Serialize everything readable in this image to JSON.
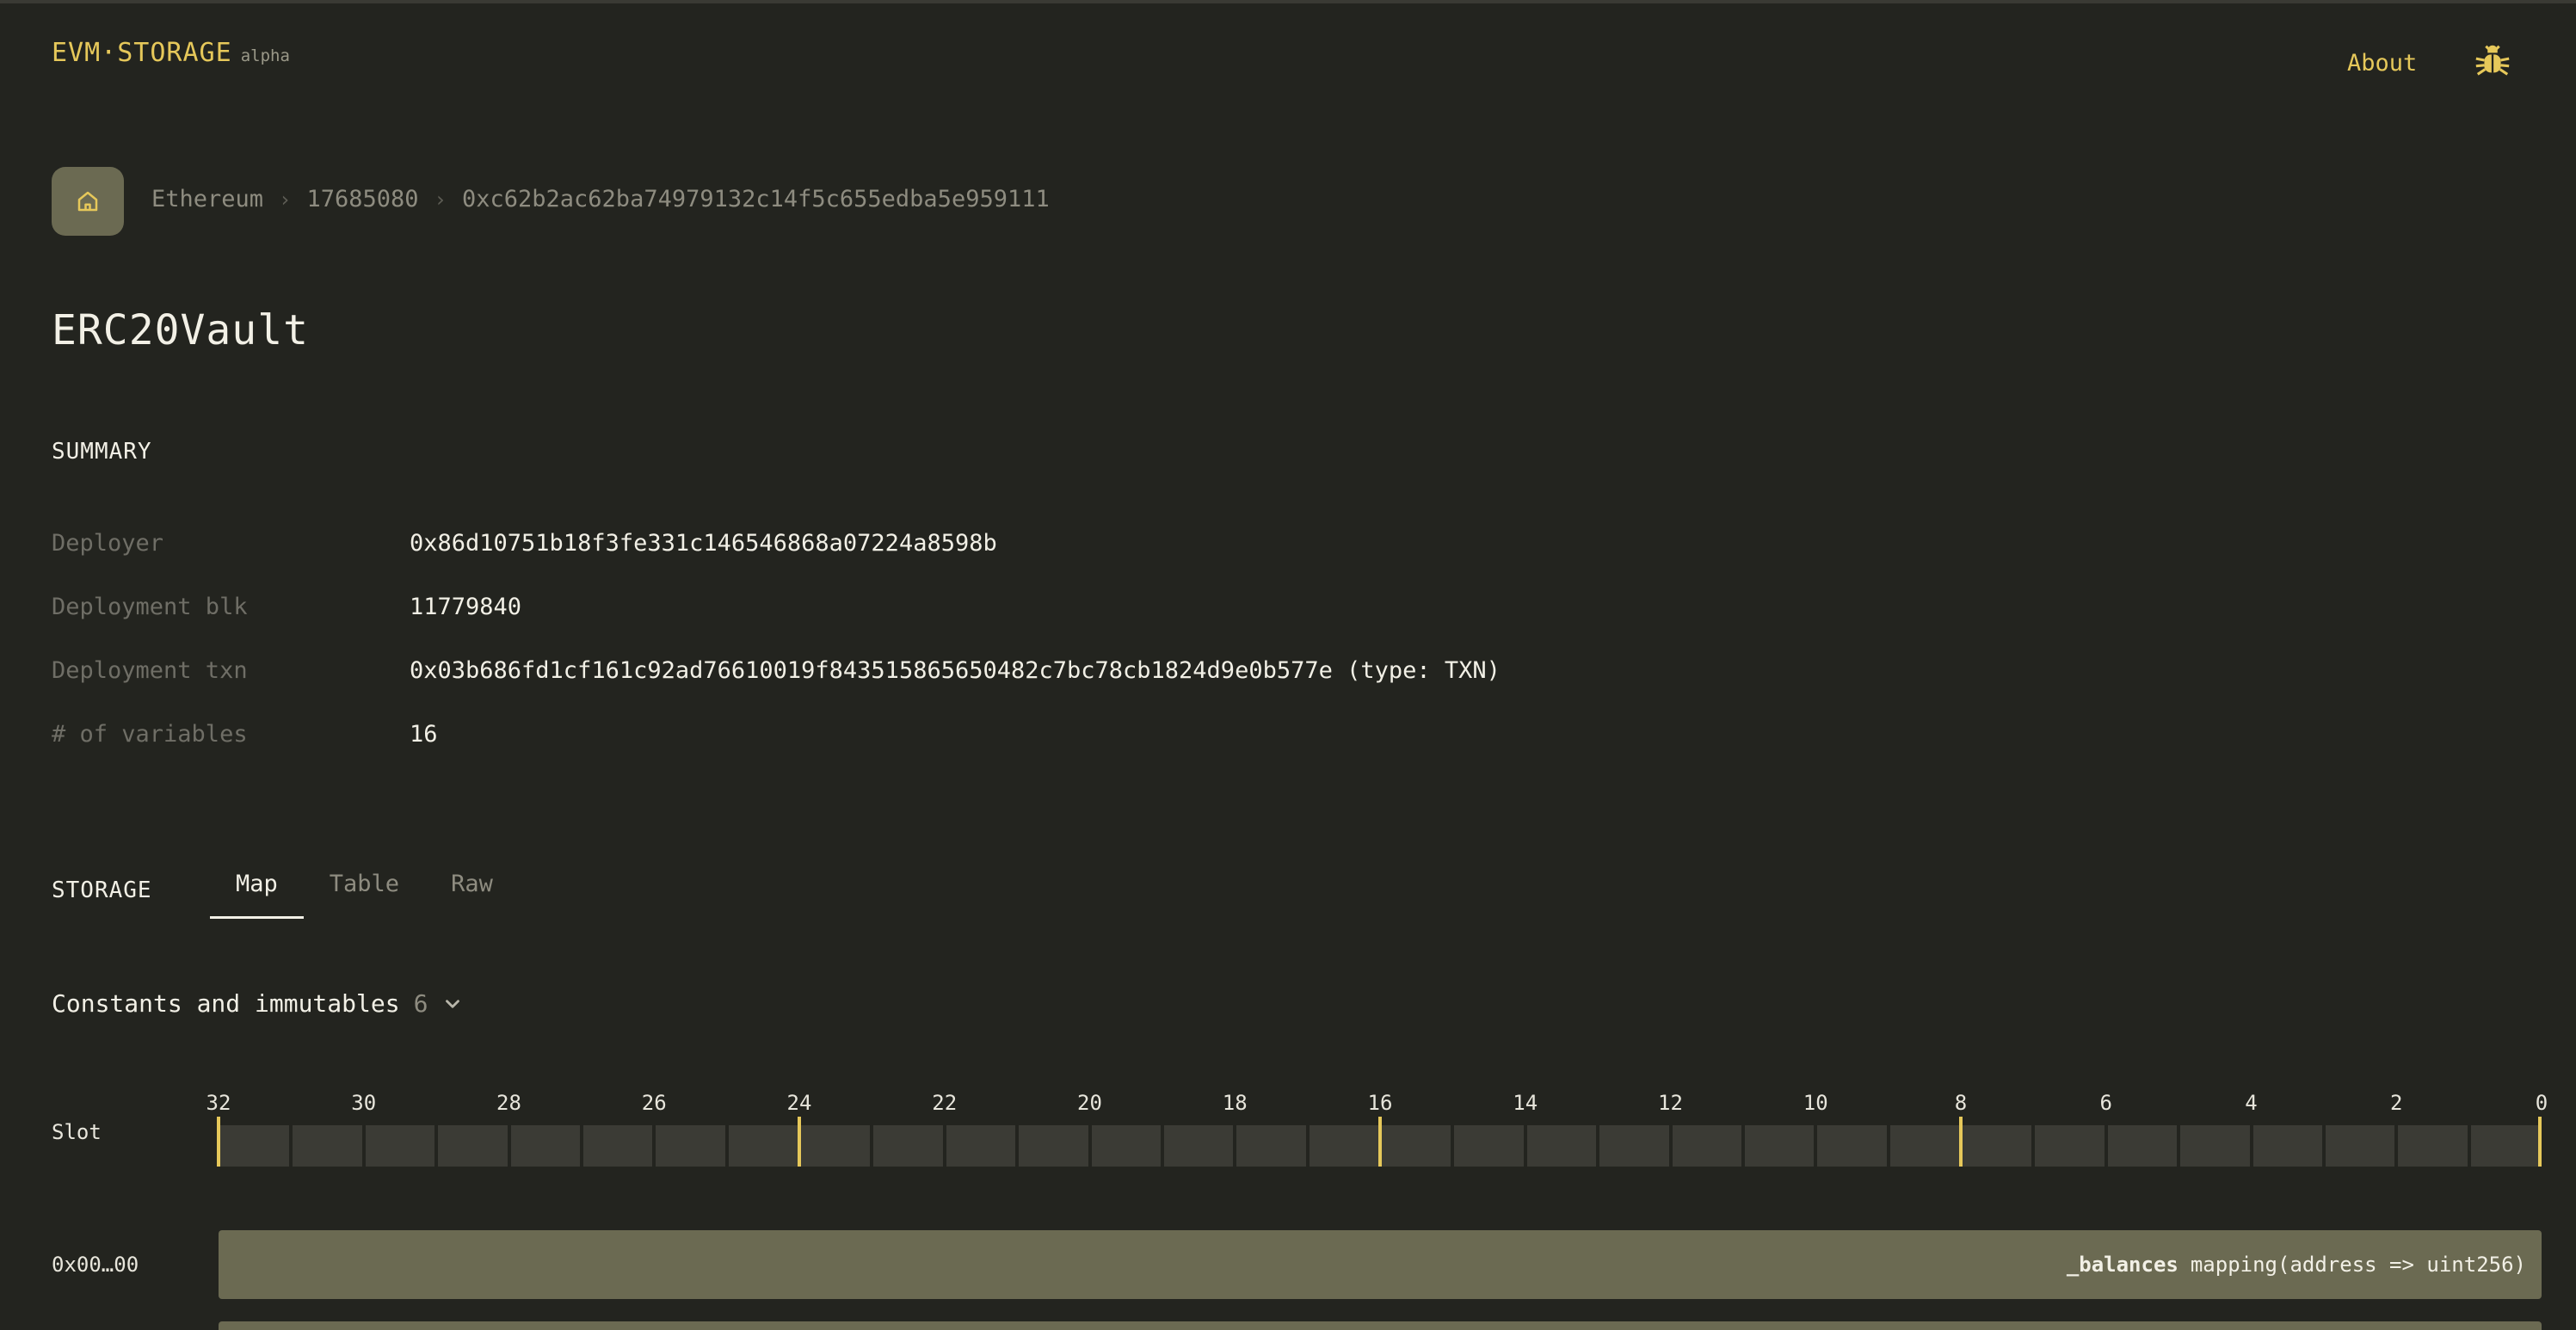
{
  "header": {
    "brand": "EVM·STORAGE",
    "brand_badge": "alpha",
    "about": "About",
    "bug_icon": "bug-icon",
    "accent_color": "#e6c85a"
  },
  "breadcrumb": {
    "home_icon": "home-icon",
    "items": [
      "Ethereum",
      "17685080",
      "0xc62b2ac62ba74979132c14f5c655edba5e959111"
    ]
  },
  "contract": {
    "name": "ERC20Vault"
  },
  "summary": {
    "heading": "SUMMARY",
    "rows": [
      {
        "label": "Deployer",
        "value": "0x86d10751b18f3fe331c146546868a07224a8598b"
      },
      {
        "label": "Deployment blk",
        "value": "11779840"
      },
      {
        "label": "Deployment txn",
        "value": "0x03b686fd1cf161c92ad76610019f843515865650482c7bc78cb1824d9e0b577e (type: TXN)"
      },
      {
        "label": "# of variables",
        "value": "16"
      }
    ]
  },
  "storage": {
    "heading": "STORAGE",
    "tabs": [
      "Map",
      "Table",
      "Raw"
    ],
    "active_tab": "Map",
    "constants_label": "Constants and immutables",
    "constants_count": "6",
    "slot_label": "Slot",
    "tick_labels": [
      "32",
      "30",
      "28",
      "26",
      "24",
      "22",
      "20",
      "18",
      "16",
      "14",
      "12",
      "10",
      "8",
      "6",
      "4",
      "2",
      "0"
    ],
    "marker_bytes": [
      32,
      24,
      16,
      8,
      0
    ],
    "rows": [
      {
        "slot": "0x00…00",
        "var_name": "_balances",
        "var_type": "mapping(address => uint256)"
      }
    ]
  }
}
